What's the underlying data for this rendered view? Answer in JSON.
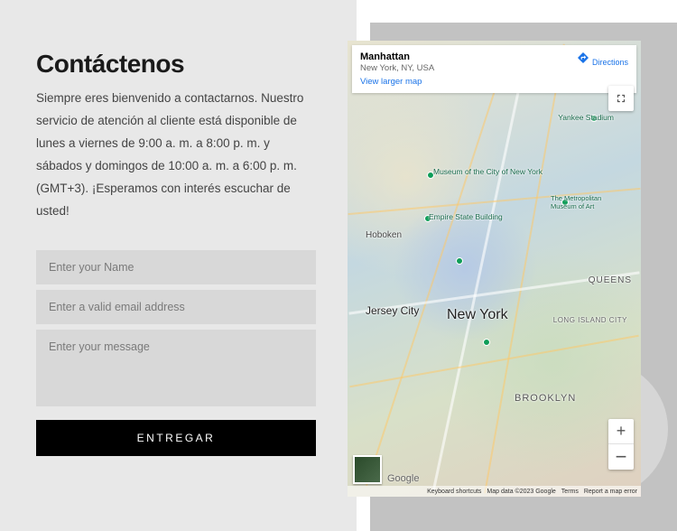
{
  "heading": "Contáctenos",
  "description": "Siempre eres bienvenido a contactarnos. Nuestro servicio de atención al cliente está disponible de lunes a viernes de 9:00 a. m. a 8:00 p. m. y sábados y domingos de 10:00 a. m. a 6:00 p. m. (GMT+3). ¡Esperamos con interés escuchar de usted!",
  "form": {
    "name_placeholder": "Enter your Name",
    "email_placeholder": "Enter a valid email address",
    "message_placeholder": "Enter your message",
    "submit_label": "ENTREGAR"
  },
  "map": {
    "info_title": "Manhattan",
    "info_subtitle": "New York, NY, USA",
    "view_larger": "View larger map",
    "directions": "Directions",
    "labels": {
      "ny": "New York",
      "jc": "Jersey City",
      "bk": "BROOKLYN",
      "qn": "QUEENS",
      "hb": "Hoboken",
      "li": "LONG ISLAND CITY",
      "mc": "Museum of the City of New York",
      "es": "Empire State Building",
      "ys": "Yankee Stadium",
      "tm": "The Metropolitan Museum of Art"
    },
    "footer": {
      "shortcuts": "Keyboard shortcuts",
      "mapdata": "Map data ©2023 Google",
      "terms": "Terms",
      "report": "Report a map error"
    },
    "google": "Google"
  }
}
